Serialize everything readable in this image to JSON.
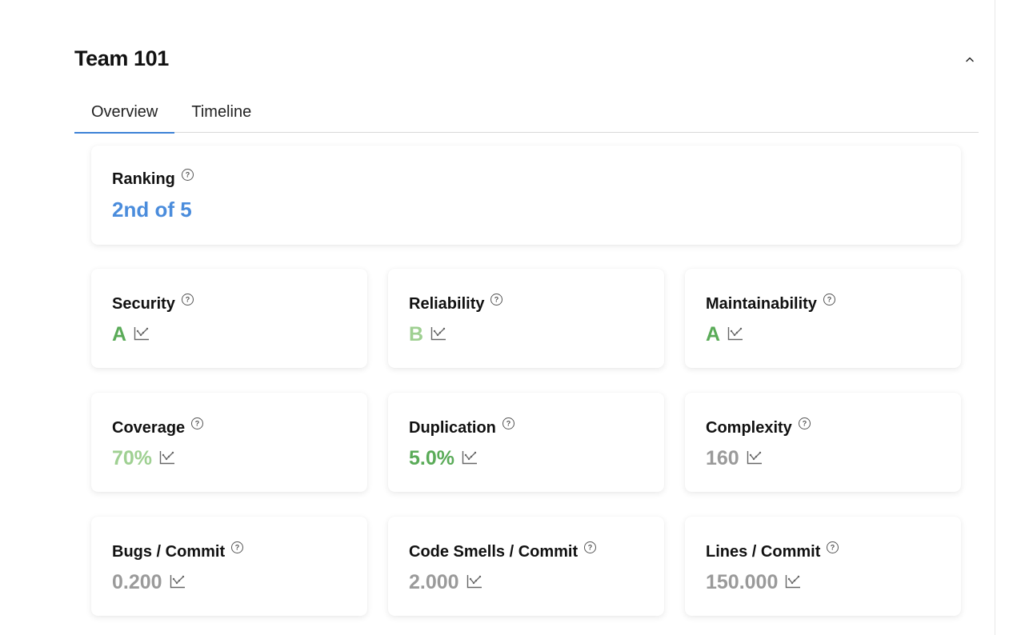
{
  "header": {
    "title": "Team 101"
  },
  "tabs": [
    {
      "label": "Overview",
      "active": true
    },
    {
      "label": "Timeline",
      "active": false
    }
  ],
  "ranking": {
    "label": "Ranking",
    "value": "2nd of 5",
    "color": "#4a8cdc"
  },
  "metrics": [
    {
      "label": "Security",
      "value": "A",
      "color": "#5aab58"
    },
    {
      "label": "Reliability",
      "value": "B",
      "color": "#9fd092"
    },
    {
      "label": "Maintainability",
      "value": "A",
      "color": "#5aab58"
    },
    {
      "label": "Coverage",
      "value": "70%",
      "color": "#9fd092"
    },
    {
      "label": "Duplication",
      "value": "5.0%",
      "color": "#5aab58"
    },
    {
      "label": "Complexity",
      "value": "160",
      "color": "#9a9a9a"
    },
    {
      "label": "Bugs / Commit",
      "value": "0.200",
      "color": "#9a9a9a"
    },
    {
      "label": "Code Smells / Commit",
      "value": "2.000",
      "color": "#9a9a9a"
    },
    {
      "label": "Lines / Commit",
      "value": "150.000",
      "color": "#9a9a9a"
    }
  ],
  "icons": {
    "collapse": "chevron-up-icon",
    "help": "question-circle-icon",
    "chart": "line-chart-icon"
  }
}
